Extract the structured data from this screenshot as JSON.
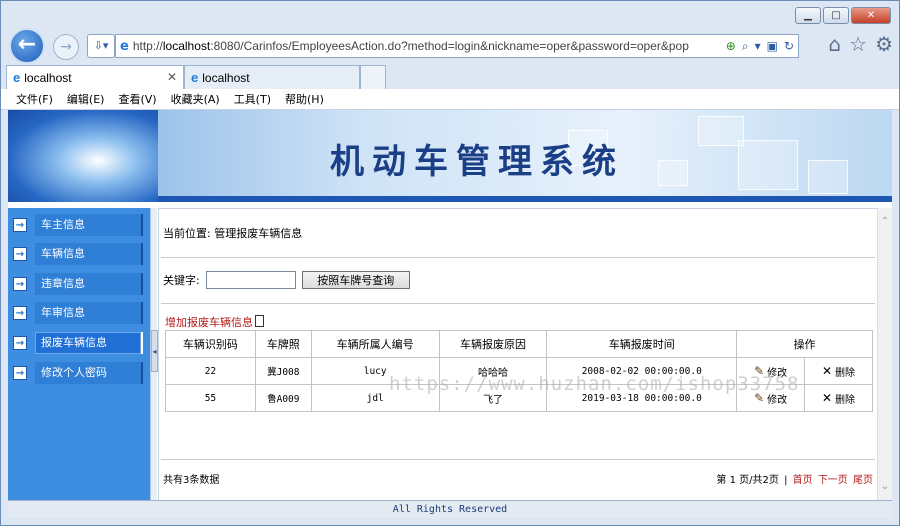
{
  "browser": {
    "address_url_prefix": "http://",
    "address_url_host": "localhost",
    "address_url_rest": ":8080/Carinfos/EmployeesAction.do?method=login&nickname=oper&password=oper&pop",
    "tabs": [
      {
        "label": "localhost"
      },
      {
        "label": "localhost"
      }
    ],
    "menu": [
      "文件(F)",
      "编辑(E)",
      "查看(V)",
      "收藏夹(A)",
      "工具(T)",
      "帮助(H)"
    ]
  },
  "app": {
    "title": "机动车管理系统",
    "footer": "All Rights Reserved"
  },
  "sidebar": {
    "items": [
      {
        "label": "车主信息"
      },
      {
        "label": "车辆信息"
      },
      {
        "label": "违章信息"
      },
      {
        "label": "年审信息"
      },
      {
        "label": "报废车辆信息"
      },
      {
        "label": "修改个人密码"
      }
    ],
    "active_index": 4
  },
  "main": {
    "location": "当前位置: 管理报废车辆信息",
    "search_label": "关键字:",
    "search_value": "",
    "search_button": "按照车牌号查询",
    "add_link": "增加报废车辆信息",
    "table": {
      "headers": [
        "车辆识别码",
        "车牌照",
        "车辆所属人编号",
        "车辆报废原因",
        "车辆报废时间",
        "操作"
      ],
      "rows": [
        {
          "id": "22",
          "plate": "冀J008",
          "owner": "lucy",
          "reason": "哈哈哈",
          "time": "2008-02-02 00:00:00.0"
        },
        {
          "id": "55",
          "plate": "鲁A009",
          "owner": "jdl",
          "reason": "飞了",
          "time": "2019-03-18 00:00:00.0"
        }
      ],
      "edit_label": "修改",
      "delete_label": "删除"
    },
    "total": "共有3条数据",
    "pager": {
      "info": "第 1 页/共2页",
      "first": "首页",
      "next": "下一页",
      "last": "尾页"
    }
  },
  "watermark": "https://www.huzhan.com/ishop33758"
}
